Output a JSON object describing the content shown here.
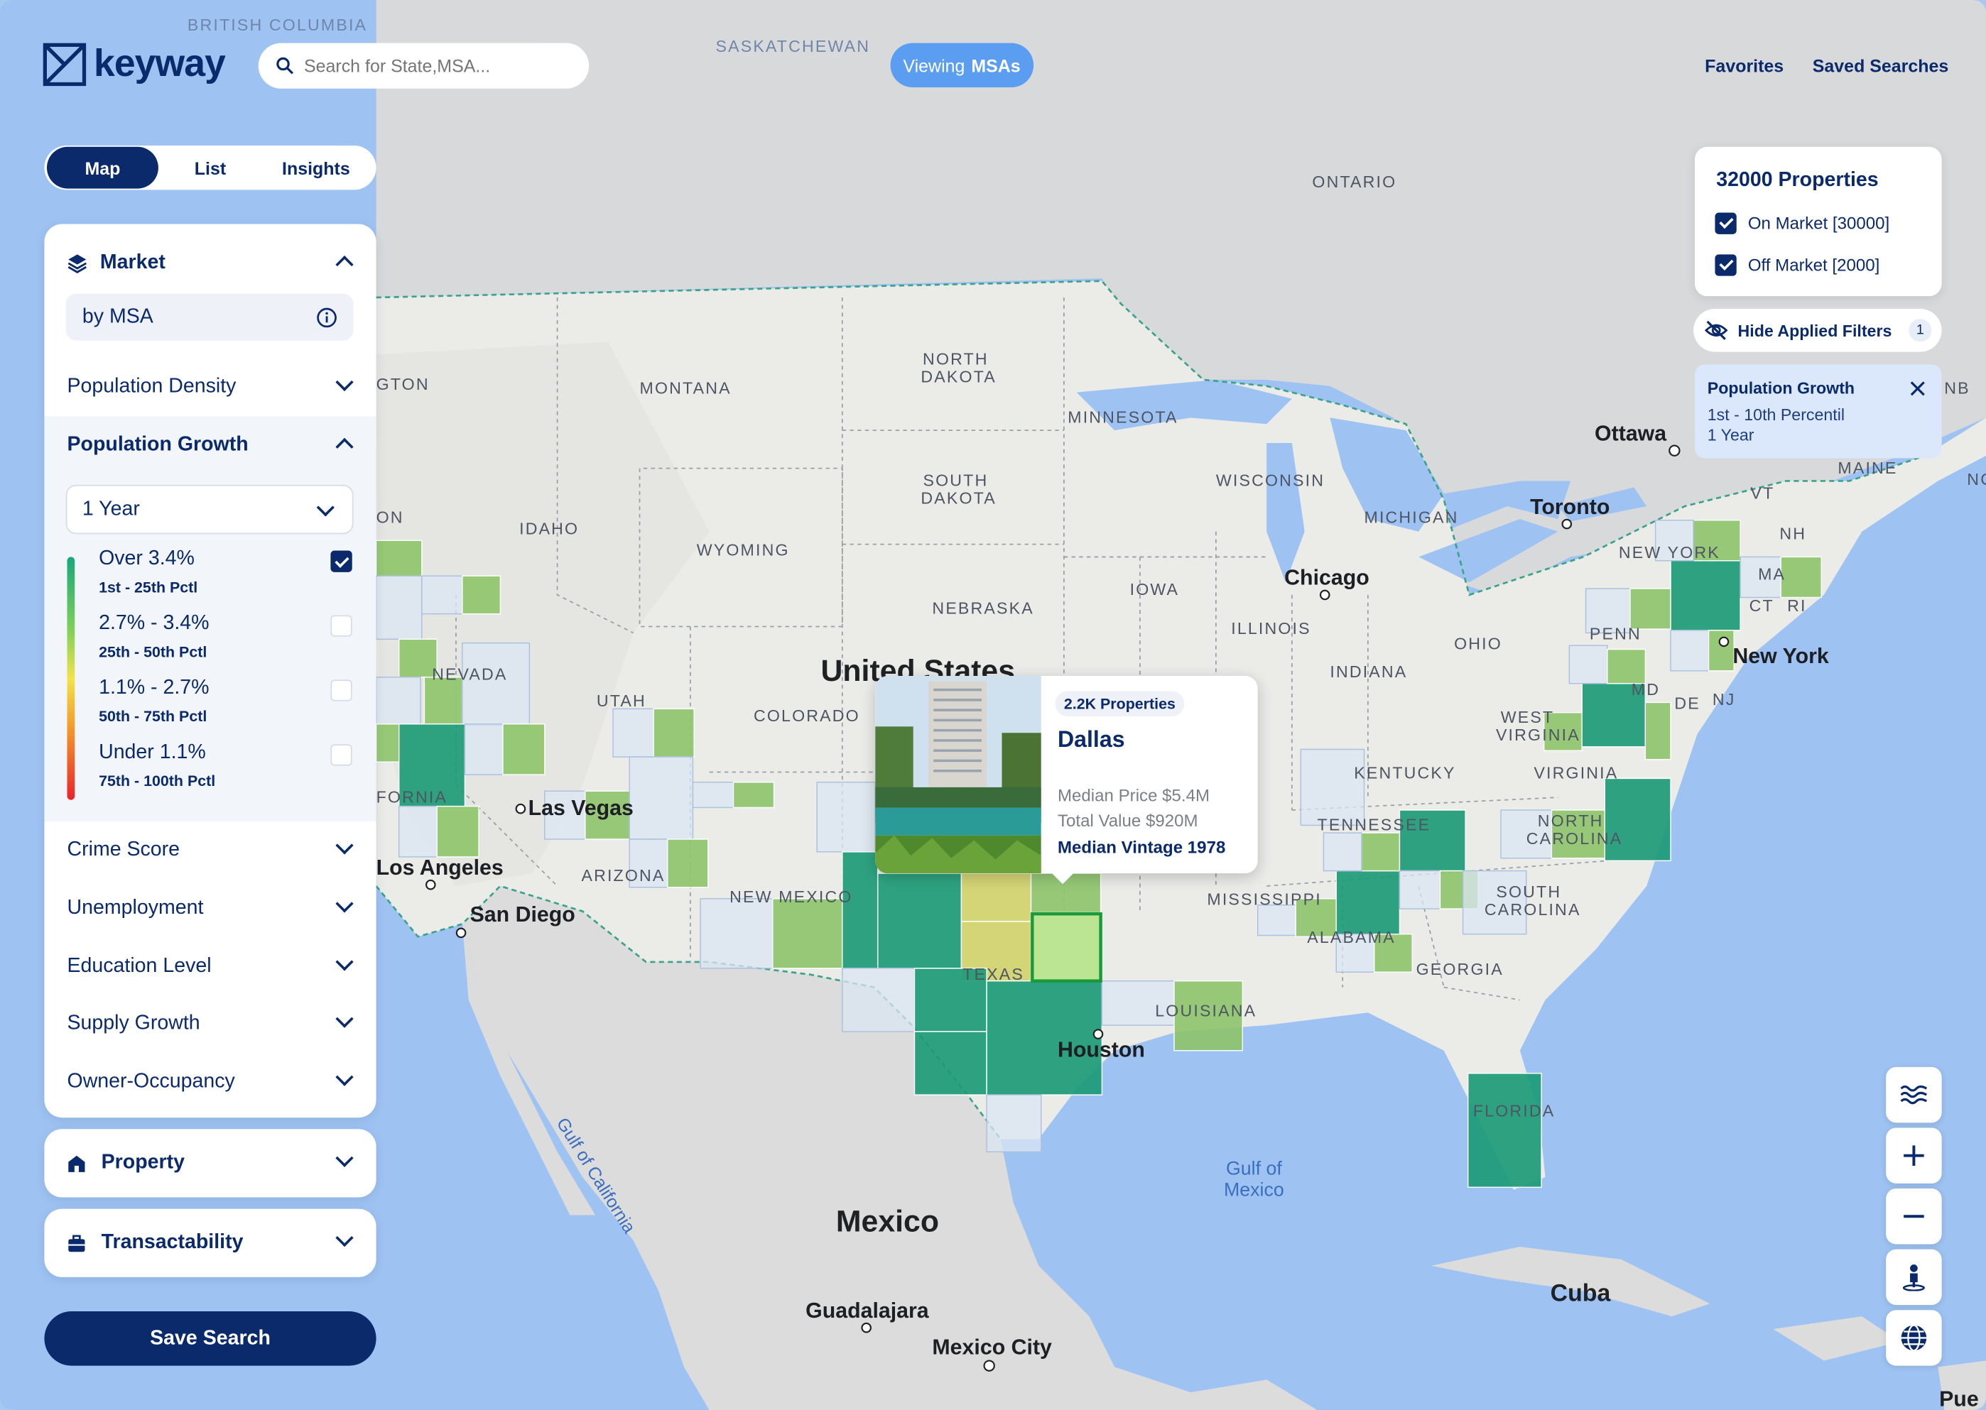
{
  "header": {
    "logo": "keyway",
    "search_placeholder": "Search for State,MSA...",
    "viewing_prefix": "Viewing",
    "viewing_value": "MSAs",
    "nav": [
      "Favorites",
      "Saved Searches"
    ]
  },
  "view_tabs": [
    "Map",
    "List",
    "Insights"
  ],
  "active_tab": "Map",
  "sidebar": {
    "market": {
      "title": "Market",
      "mode": "by MSA",
      "filters": {
        "population_density": "Population Density",
        "population_growth": {
          "title": "Population Growth",
          "period": "1 Year",
          "legend": [
            {
              "range": "Over 3.4%",
              "pctl": "1st - 25th Pctl",
              "checked": true
            },
            {
              "range": "2.7% - 3.4%",
              "pctl": "25th - 50th Pctl",
              "checked": false
            },
            {
              "range": "1.1% - 2.7%",
              "pctl": "50th - 75th Pctl",
              "checked": false
            },
            {
              "range": "Under 1.1%",
              "pctl": "75th - 100th Pctl",
              "checked": false
            }
          ]
        },
        "others": [
          "Crime Score",
          "Unemployment",
          "Education Level",
          "Supply Growth",
          "Owner-Occupancy"
        ]
      }
    },
    "property": "Property",
    "transactability": "Transactability",
    "save_button": "Save Search"
  },
  "properties_panel": {
    "title": "32000 Properties",
    "options": [
      {
        "label": "On Market [30000]",
        "checked": true
      },
      {
        "label": "Off Market [2000]",
        "checked": true
      }
    ],
    "hide_filters_label": "Hide Applied Filters",
    "hide_filters_count": "1",
    "applied_filter": {
      "title": "Population Growth",
      "line1": "1st - 10th Percentil",
      "line2": "1 Year"
    }
  },
  "popup": {
    "badge": "2.2K Properties",
    "city": "Dallas",
    "median_price": "Median Price $5.4M",
    "total_value": "Total Value $920M",
    "median_vintage": "Median Vintage 1978"
  },
  "map_labels": {
    "countries": [
      "United States",
      "Mexico",
      "Cuba"
    ],
    "regions": [
      "BRITISH COLUMBIA",
      "SASKATCHEWAN",
      "ONTARIO"
    ],
    "states": [
      "MONTANA",
      "NORTH DAKOTA",
      "SOUTH DAKOTA",
      "MINNESOTA",
      "WISCONSIN",
      "MICHIGAN",
      "IDAHO",
      "WYOMING",
      "NEBRASKA",
      "IOWA",
      "ILLINOIS",
      "INDIANA",
      "OHIO",
      "NEVADA",
      "UTAH",
      "COLORADO",
      "ARIZONA",
      "NEW MEXICO",
      "TEXAS",
      "KENTUCKY",
      "TENNESSEE",
      "WEST VIRGINIA",
      "VIRGINIA",
      "NORTH CAROLINA",
      "SOUTH CAROLINA",
      "GEORGIA",
      "ALABAMA",
      "MISSISSIPPI",
      "LOUISIANA",
      "FLORIDA",
      "PENN",
      "NEW YORK",
      "MAINE",
      "VT",
      "NH",
      "MA",
      "CT",
      "RI",
      "MD",
      "DE",
      "NJ",
      "GTON",
      "ON",
      "FORNIA",
      "NB",
      "NC"
    ],
    "cities": [
      "Ottawa",
      "Toronto",
      "Chicago",
      "New York",
      "Las Vegas",
      "Los Angeles",
      "San Diego",
      "Houston",
      "Guadalajara",
      "Mexico City",
      "Pue"
    ],
    "water": [
      "Gulf of Mexico",
      "Gulf of California"
    ]
  },
  "colors": {
    "navy": "#0b2a6b",
    "accent_blue": "#5b9df0",
    "ocean": "#9ec3f2",
    "land": "#dcdcdc",
    "us_land": "#ececea",
    "dark_green": "#1a9a74",
    "mid_green": "#8dc46a",
    "light_green": "#b6e48a",
    "yellow_green": "#d2d36a",
    "pale_blue": "#dbe6f3"
  }
}
